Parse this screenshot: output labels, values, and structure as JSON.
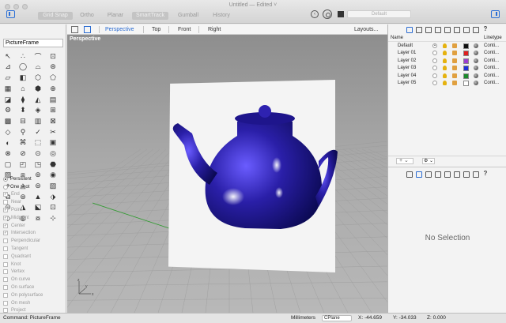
{
  "window": {
    "title": "Untitled — Edited ˅"
  },
  "modes": [
    {
      "label": "Grid Snap",
      "on": true
    },
    {
      "label": "Ortho",
      "on": false
    },
    {
      "label": "Planar",
      "on": false
    },
    {
      "label": "SmartTrack",
      "on": true
    },
    {
      "label": "Gumball",
      "on": false
    },
    {
      "label": "History",
      "on": false
    }
  ],
  "toolbar": {
    "layer_value": "Default"
  },
  "command": {
    "value": "PictureFrame"
  },
  "viewport_tabs": {
    "perspective": "Perspective",
    "top": "Top",
    "front": "Front",
    "right": "Right",
    "layouts": "Layouts..."
  },
  "viewport": {
    "label": "Perspective"
  },
  "osnap": {
    "persistent": "Persistent",
    "one_shot": "One shot",
    "items": [
      {
        "label": "End",
        "checked": true
      },
      {
        "label": "Near",
        "checked": false
      },
      {
        "label": "Point",
        "checked": true
      },
      {
        "label": "Midpoint",
        "checked": true
      },
      {
        "label": "Center",
        "checked": true
      },
      {
        "label": "Intersection",
        "checked": true
      },
      {
        "label": "Perpendicular",
        "checked": false
      },
      {
        "label": "Tangent",
        "checked": false
      },
      {
        "label": "Quadrant",
        "checked": false
      },
      {
        "label": "Knot",
        "checked": false
      },
      {
        "label": "Vertex",
        "checked": false
      },
      {
        "label": "On curve",
        "checked": false
      },
      {
        "label": "On surface",
        "checked": false
      },
      {
        "label": "On polysurface",
        "checked": false
      },
      {
        "label": "On mesh",
        "checked": false
      },
      {
        "label": "Project",
        "checked": false
      }
    ]
  },
  "layers": {
    "header_name": "Name",
    "header_linetype": "Linetype",
    "rows": [
      {
        "name": "Default",
        "color": "#111111",
        "linetype": "Conti...",
        "current": true
      },
      {
        "name": "Layer 01",
        "color": "#e02020",
        "linetype": "Conti...",
        "current": false
      },
      {
        "name": "Layer 02",
        "color": "#9b3fd0",
        "linetype": "Conti...",
        "current": false
      },
      {
        "name": "Layer 03",
        "color": "#2030d8",
        "linetype": "Conti...",
        "current": false
      },
      {
        "name": "Layer 04",
        "color": "#1a8a2a",
        "linetype": "Conti...",
        "current": false
      },
      {
        "name": "Layer 05",
        "color": "#ffffff",
        "linetype": "Conti...",
        "current": false
      }
    ]
  },
  "properties": {
    "empty_text": "No Selection"
  },
  "status": {
    "command_label": "Command: PictureFrame",
    "units": "Millimeters",
    "cplane": "CPlane",
    "x": "X: -44.659",
    "y": "Y: -34.033",
    "z": "Z: 0.000"
  }
}
